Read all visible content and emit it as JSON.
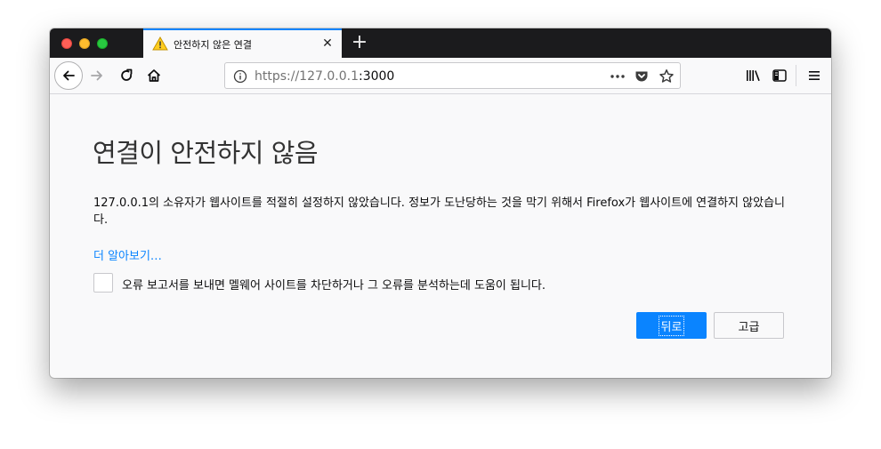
{
  "tab": {
    "title": "안전하지 않은 연결",
    "close_glyph": "✕",
    "newtab_glyph": "+"
  },
  "toolbar": {
    "url_prefix": "https://127.0.0.1",
    "url_suffix": ":3000"
  },
  "page": {
    "title": "연결이 안전하지 않음",
    "description": "127.0.0.1의 소유자가 웹사이트를 적절히 설정하지 않았습니다. 정보가 도난당하는 것을 막기 위해서 Firefox가 웹사이트에 연결하지 않았습니다.",
    "learn_more": "더 알아보기…",
    "report_label": "오류 보고서를 보내면 멜웨어 사이트를 차단하거나 그 오류를 분석하는데 도움이 됩니다.",
    "back_button": "뒤로",
    "advanced_button": "고급"
  },
  "colors": {
    "accent": "#0a84ff",
    "tabbar": "#1b1b1d",
    "page_bg": "#f9f9fa"
  },
  "icons": [
    "warning-icon",
    "close-icon",
    "plus-icon",
    "back-arrow-icon",
    "forward-arrow-icon",
    "reload-icon",
    "home-icon",
    "info-icon",
    "more-icon",
    "pocket-icon",
    "star-icon",
    "library-icon",
    "sidebar-icon",
    "menu-icon"
  ]
}
